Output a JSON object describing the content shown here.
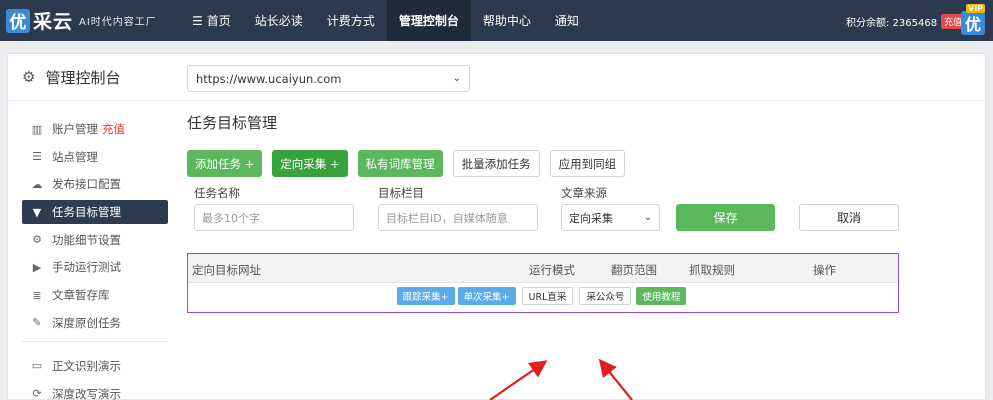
{
  "brand": {
    "logo_char": "优",
    "name": "采云",
    "slogan": "AI时代内容工厂"
  },
  "nav": {
    "items": [
      {
        "label": "首页"
      },
      {
        "label": "站长必读"
      },
      {
        "label": "计费方式"
      },
      {
        "label": "管理控制台"
      },
      {
        "label": "帮助中心"
      },
      {
        "label": "通知"
      }
    ],
    "score_text": "积分余额: 2365468",
    "recharge_label": "充值",
    "avatar_char": "优",
    "vip_label": "VIP"
  },
  "panel": {
    "title": "管理控制台"
  },
  "sidebar": {
    "items": [
      {
        "label": "账户管理",
        "extra": "充值",
        "icon": "bar-chart-icon"
      },
      {
        "label": "站点管理",
        "icon": "server-icon"
      },
      {
        "label": "发布接口配置",
        "icon": "cloud-upload-icon"
      },
      {
        "label": "任务目标管理",
        "icon": "filter-icon"
      },
      {
        "label": "功能细节设置",
        "icon": "gears-icon"
      },
      {
        "label": "手动运行测试",
        "icon": "play-circle-icon"
      },
      {
        "label": "文章暂存库",
        "icon": "database-icon"
      },
      {
        "label": "深度原创任务",
        "icon": "edit-icon"
      },
      {
        "label": "正文识别演示",
        "icon": "monitor-icon"
      },
      {
        "label": "深度改写演示",
        "icon": "refresh-icon"
      }
    ]
  },
  "content": {
    "site_url": "https://www.ucaiyun.com",
    "section_title": "任务目标管理",
    "buttons": {
      "add_task": "添加任务 +",
      "directed_collect": "定向采集 +",
      "private_lexicon": "私有词库管理",
      "batch_add": "批量添加任务",
      "apply_group": "应用到同组"
    },
    "form": {
      "task_name_label": "任务名称",
      "task_name_placeholder": "最多10个字",
      "target_column_label": "目标栏目",
      "target_column_placeholder": "目标栏目ID，自媒体随意",
      "source_label": "文章来源",
      "source_value": "定向采集",
      "save": "保存",
      "cancel": "取消"
    },
    "table": {
      "headers": [
        "定向目标网址",
        "运行模式",
        "翻页范围",
        "抓取规则",
        "操作"
      ],
      "actions": {
        "track_collect": "跟踪采集+",
        "single_collect": "单次采集+",
        "url_direct": "URL直采",
        "wechat_collect": "采公众号",
        "tutorial": "使用教程"
      }
    }
  },
  "colors": {
    "topbar": "#2b3a4e",
    "green": "#5cb85c",
    "blue": "#5aabe8",
    "highlight_border": "#a24bd0",
    "arrow": "#e02020"
  }
}
